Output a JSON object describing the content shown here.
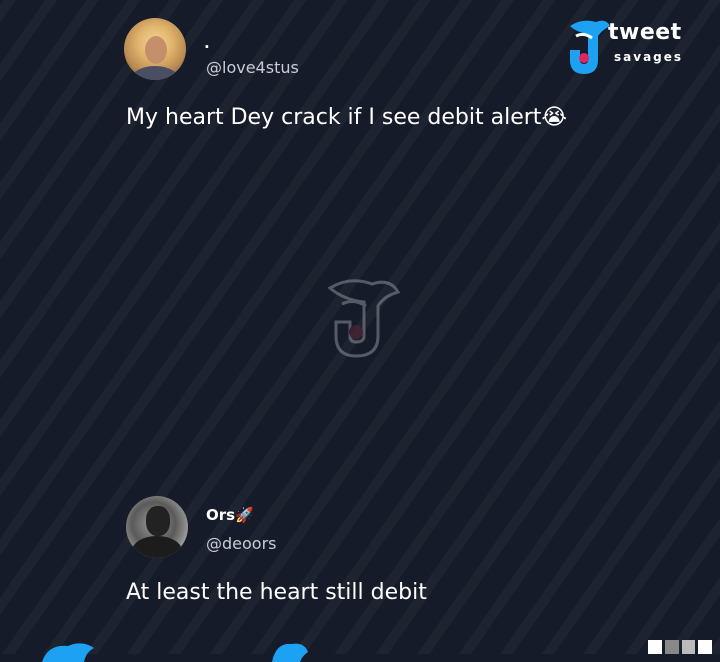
{
  "brand": {
    "word1": "tweet",
    "word2": "savages",
    "accent": "#1da1f2",
    "heart_color": "#e0245e"
  },
  "tweet1": {
    "display_name": ".",
    "handle": "@love4stus",
    "text": "My heart Dey crack if I see debit alert😭"
  },
  "tweet2": {
    "display_name": "Ors🚀",
    "handle": "@deoors",
    "text": "At least the heart still debit"
  },
  "icons": [
    "tweet-savages-logo-icon",
    "watermark-logo-icon",
    "twitter-bird-icon",
    "qr-code-icon"
  ]
}
